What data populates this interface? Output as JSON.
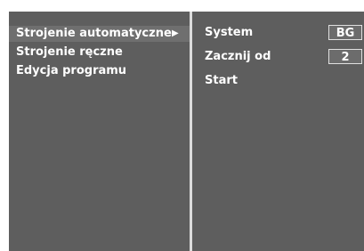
{
  "left_menu": {
    "items": [
      {
        "label": "Strojenie automatyczne",
        "selected": true
      },
      {
        "label": "Strojenie ręczne",
        "selected": false
      },
      {
        "label": "Edycja programu",
        "selected": false
      }
    ],
    "selected_arrow_icon": "right-triangle-icon",
    "arrow_glyph": "▶"
  },
  "right_panel": {
    "system_label": "System",
    "system_value": "BG",
    "start_from_label": "Zacznij od",
    "start_from_value": "2",
    "start_label": "Start"
  },
  "colors": {
    "menu_background": "#5e5e5e",
    "selected_row_background": "#6f6f6f",
    "divider": "#dcdcdc",
    "value_box_border": "#e0e0e0",
    "text": "#ffffff"
  }
}
